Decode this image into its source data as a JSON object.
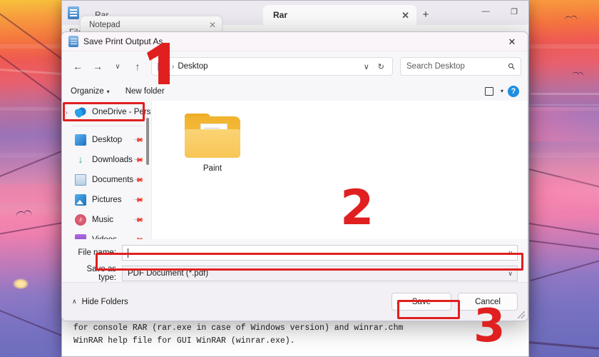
{
  "desktop": {
    "wallpaper_colors": [
      "#f7c23c",
      "#ef5a52",
      "#e08ab0",
      "#8f78c4",
      "#6a68b8"
    ]
  },
  "notepad_window": {
    "app_icon": "notepad-icon",
    "tabs": [
      {
        "label": "Rar",
        "active": false,
        "close": "✕"
      },
      {
        "label": "Rar",
        "active": true,
        "close": "✕"
      }
    ],
    "inner_tab": {
      "label": "Notepad",
      "close": "✕"
    },
    "new_tab": "+",
    "window_controls": {
      "minimize": "—",
      "maximize": "❐",
      "close": "✕"
    },
    "menu": [
      "File"
    ],
    "document_text": "for console RAR (rar.exe in case of Windows version) and winrar.chm\nWinRAR help file for GUI WinRAR (winrar.exe)."
  },
  "dialog": {
    "title": "Save Print Output As",
    "title_icon": "notepad-document-icon",
    "close_label": "✕",
    "nav": {
      "back": "←",
      "forward": "→",
      "recent": "∨",
      "up": "↑"
    },
    "breadcrumb": {
      "root_icon": "this-pc-icon",
      "separator": "›",
      "current": "Desktop",
      "dropdown": "∨",
      "refresh": "↻"
    },
    "search": {
      "placeholder": "Search Desktop",
      "icon": "search-icon"
    },
    "commandbar": {
      "organize": "Organize",
      "organize_caret": "▾",
      "new_folder": "New folder",
      "view_icon": "view-layout-icon",
      "view_caret": "▾",
      "help_icon": "help-icon",
      "help_glyph": "?"
    },
    "sidebar": {
      "items": [
        {
          "label": "OneDrive - Pers",
          "icon": "onedrive-icon",
          "chevron": "›",
          "pin": "",
          "highlighted": true
        },
        {
          "label": "Desktop",
          "icon": "desktop-icon",
          "pin": "📌"
        },
        {
          "label": "Downloads",
          "icon": "downloads-icon",
          "pin": "📌"
        },
        {
          "label": "Documents",
          "icon": "documents-icon",
          "pin": "📌"
        },
        {
          "label": "Pictures",
          "icon": "pictures-icon",
          "pin": "📌"
        },
        {
          "label": "Music",
          "icon": "music-icon",
          "pin": "📌"
        },
        {
          "label": "Videos",
          "icon": "videos-icon",
          "pin": "📌"
        }
      ]
    },
    "filelist": {
      "items": [
        {
          "label": "Paint",
          "type": "folder"
        }
      ]
    },
    "form": {
      "filename_label": "File name:",
      "filename_value": "",
      "filename_caret": "∨",
      "savetype_label": "Save as type:",
      "savetype_value": "PDF Document (*.pdf)",
      "savetype_caret": "∨"
    },
    "footer": {
      "hide_folders": "Hide Folders",
      "hide_folders_caret": "∧",
      "save_button": "Save",
      "cancel_button": "Cancel"
    }
  },
  "annotations": {
    "accent_color": "#e02020",
    "steps": [
      {
        "number": "1",
        "target": "onedrive-sidebar-item"
      },
      {
        "number": "2",
        "target": "filename-field"
      },
      {
        "number": "3",
        "target": "save-button"
      }
    ]
  }
}
